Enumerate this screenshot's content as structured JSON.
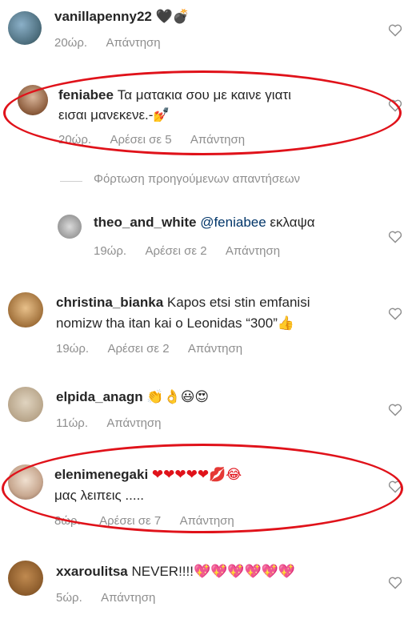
{
  "comments": [
    {
      "username": "vanillapenny22",
      "text": "",
      "emojis": "🖤💣",
      "time": "20ώρ.",
      "likes": "",
      "reply": "Απάντηση"
    },
    {
      "username": "feniabee",
      "text": "Τα ματακια σου με καινε γιατι",
      "text2": "εισαι μανεκενε.-💅",
      "time": "20ώρ.",
      "likes": "Αρέσει σε 5",
      "reply": "Απάντηση"
    },
    {
      "username": "theo_and_white",
      "mention": "@feniabee",
      "text": " εκλαψα",
      "time": "19ώρ.",
      "likes": "Αρέσει σε 2",
      "reply": "Απάντηση"
    },
    {
      "username": "christina_bianka",
      "text": "Kapos etsi stin emfanisi",
      "text2": "nomizw tha itan kai o Leonidas “300”👍",
      "time": "19ώρ.",
      "likes": "Αρέσει σε 2",
      "reply": "Απάντηση"
    },
    {
      "username": "elpida_anagn",
      "text": "👏👌😃😍",
      "time": "11ώρ.",
      "likes": "",
      "reply": "Απάντηση"
    },
    {
      "username": "elenimenegaki",
      "text": "❤❤❤❤❤💋😂",
      "text2": "μας λειπεις .....",
      "time": "8ώρ.",
      "likes": "Αρέσει σε 7",
      "reply": "Απάντηση"
    },
    {
      "username": "xxaroulitsa",
      "text": "NEVER!!!!💖💖💖💖💖💖",
      "time": "5ώρ.",
      "likes": "",
      "reply": "Απάντηση"
    }
  ],
  "load_previous": "Φόρτωση προηγούμενων απαντήσεων",
  "colors": {
    "highlight_oval": "#e0121a",
    "meta_gray": "#8e8e8e",
    "text": "#262626",
    "mention": "#003569"
  }
}
